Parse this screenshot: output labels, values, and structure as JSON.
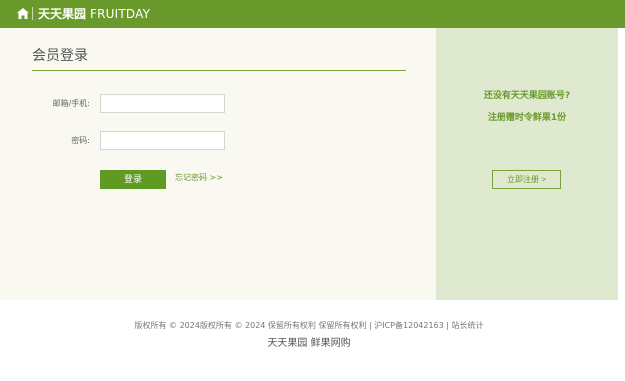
{
  "header": {
    "brand_cn": "天天果园",
    "brand_en": "FRUITDAY",
    "home_icon": "home-icon"
  },
  "login": {
    "title": "会员登录",
    "username_label": "邮箱/手机:",
    "username_value": "",
    "password_label": "密码:",
    "password_value": "",
    "submit_label": "登录",
    "forgot_label": "忘记密码 >>"
  },
  "promo": {
    "line1": "还没有天天果园账号?",
    "line2": "注册赠时令鲜果1份",
    "register_label": "立即注册 >"
  },
  "footer": {
    "copyright": "版权所有 © 2024版权所有 © 2024 保留所有权利 保留所有权利 | 沪ICP备12042163 | 站长统计",
    "tagline": "天天果园 鲜果网购"
  },
  "colors": {
    "brand_green": "#6a9a2c",
    "button_green": "#5f9a22",
    "panel_bg": "#f9f8f1",
    "promo_bg": "#dfe9cf"
  }
}
